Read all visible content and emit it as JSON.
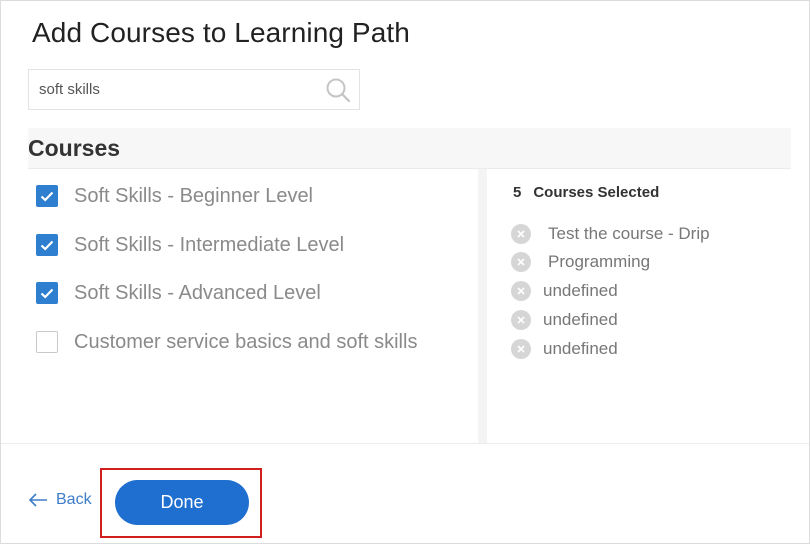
{
  "page": {
    "title": "Add Courses to Learning Path"
  },
  "search": {
    "value": "soft skills",
    "icon": "search-icon"
  },
  "courses": {
    "heading": "Courses",
    "items": [
      {
        "label": "Soft Skills - Beginner Level",
        "checked": true
      },
      {
        "label": "Soft Skills - Intermediate Level",
        "checked": true
      },
      {
        "label": "Soft Skills - Advanced Level",
        "checked": true
      },
      {
        "label": "Customer service basics and soft skills",
        "checked": false
      }
    ]
  },
  "selected": {
    "count": "5",
    "label": "Courses Selected",
    "items": [
      {
        "label": "Test the course - Drip"
      },
      {
        "label": "Programming"
      },
      {
        "label": "undefined"
      },
      {
        "label": "undefined"
      },
      {
        "label": "undefined"
      }
    ]
  },
  "footer": {
    "back_label": "Back",
    "done_label": "Done"
  },
  "colors": {
    "accent": "#1f6fd0",
    "checkbox": "#2f7fd0",
    "highlight_border": "#d11f1f"
  }
}
